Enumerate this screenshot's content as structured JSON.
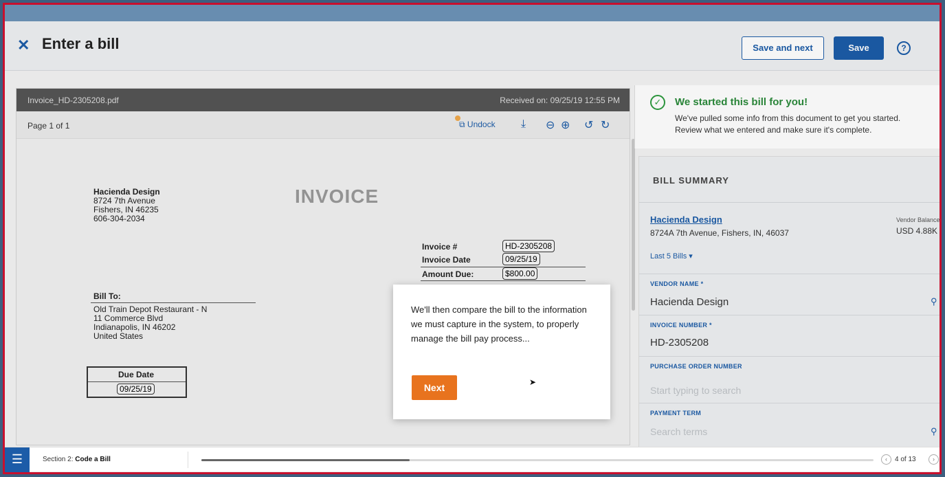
{
  "header": {
    "close_icon": "✕",
    "title": "Enter a bill",
    "save_next_label": "Save and next",
    "save_label": "Save",
    "help_icon": "?"
  },
  "doc": {
    "filename": "Invoice_HD-2305208.pdf",
    "received": "Received on: 09/25/19 12:55 PM",
    "page_label": "Page 1 of 1",
    "undock_label": "Undock",
    "vendor_name": "Hacienda Design",
    "vendor_addr1": "8724 7th Avenue",
    "vendor_addr2": "Fishers, IN 46235",
    "vendor_phone": "606-304-2034",
    "title": "INVOICE",
    "invoice_no_label": "Invoice #",
    "invoice_no": "HD-2305208",
    "invoice_date_label": "Invoice Date",
    "invoice_date": "09/25/19",
    "amount_due_label": "Amount Due:",
    "amount_due": "$800.00",
    "bill_to_label": "Bill To:",
    "bill_to_1": "Old Train Depot Restaurant - N",
    "bill_to_2": "11 Commerce Blvd",
    "bill_to_3": "Indianapolis, IN 46202",
    "bill_to_4": "United States",
    "due_date_label": "Due Date",
    "due_date": "09/25/19"
  },
  "notice": {
    "title": "We started this bill for you!",
    "line1": "We've pulled some info from this document to get you started.",
    "line2": "Review what we entered and make sure it's complete."
  },
  "summary": {
    "heading": "BILL SUMMARY",
    "vendor_link": "Hacienda Design",
    "vendor_address": "8724A 7th Avenue, Fishers, IN, 46037",
    "vendor_balance_label": "Vendor Balance",
    "vendor_balance_value": "USD 4.88K",
    "last_bills": "Last 5 Bills ▾",
    "vendor_name_label": "VENDOR NAME *",
    "vendor_name_value": "Hacienda Design",
    "invoice_number_label": "INVOICE NUMBER *",
    "invoice_number_value": "HD-2305208",
    "po_label": "PURCHASE ORDER NUMBER",
    "po_placeholder": "Start typing to search",
    "payment_term_label": "PAYMENT TERM",
    "payment_term_placeholder": "Search terms"
  },
  "modal": {
    "text": "We'll then compare the bill to the information we must capture in the system, to properly manage the bill pay process...",
    "next_label": "Next"
  },
  "bottom": {
    "section_prefix": "Section 2: ",
    "section_name": "Code a Bill",
    "progress": 0.31,
    "page_count": "4 of 13"
  }
}
